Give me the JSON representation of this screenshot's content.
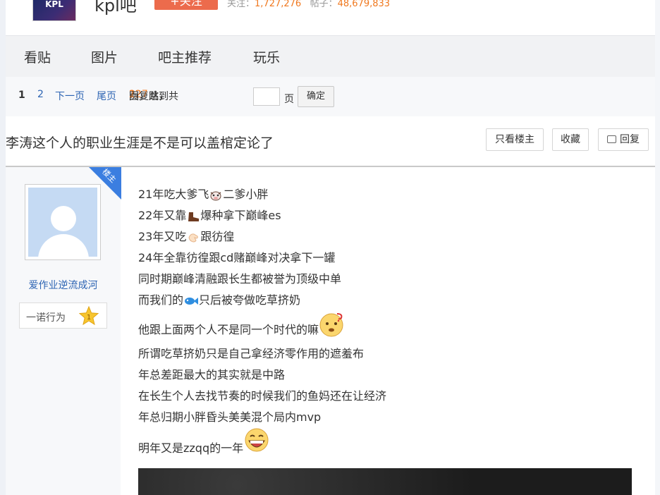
{
  "forum": {
    "logo_text": "KPL",
    "name": "kpl吧",
    "follow_label": "+关注",
    "followers_label": "关注：",
    "followers": "1,727,276",
    "posts_label": "帖子：",
    "posts": "48,679,833"
  },
  "nav": {
    "tabs": [
      "看贴",
      "图片",
      "吧主推荐",
      "玩乐"
    ]
  },
  "pager": {
    "current": "1",
    "page2": "2",
    "next": "下一页",
    "last": "尾页",
    "replies": "127",
    "replies_label": "回复贴，共",
    "pages": "2",
    "pages_label": "页，跳到",
    "page_unit": "页",
    "confirm": "确定"
  },
  "thread": {
    "title": "李涛这个人的职业生涯是不是可以盖棺定论了",
    "only_op": "只看楼主",
    "favorite": "收藏",
    "reply": "回复"
  },
  "post": {
    "op_badge": "楼主",
    "username": "爱作业逆流成河",
    "level_name": "一诺行为",
    "level_num": "1",
    "lines": [
      {
        "pre": "21年吃大爹飞",
        "icon": "cow-emoji",
        "post": "二爹小胖"
      },
      {
        "pre": "22年又靠",
        "icon": "boot-emoji",
        "post": "爆种拿下巅峰es"
      },
      {
        "pre": "23年又吃",
        "icon": "hand-emoji",
        "post": "跟彷徨"
      },
      {
        "pre": "24年全靠彷徨跟cd赌巅峰对决拿下一罐",
        "icon": "",
        "post": ""
      },
      {
        "pre": "同时期巅峰清融跟长生都被誉为顶级中单",
        "icon": "",
        "post": ""
      },
      {
        "pre": "而我们的",
        "icon": "fish-emoji",
        "post": "只后被夸做吃草挤奶"
      },
      {
        "pre": "他跟上面两个人不是同一个时代的嘛",
        "icon": "confused-face-emoji",
        "post": ""
      },
      {
        "pre": "所谓吃草挤奶只是自己拿经济零作用的遮羞布",
        "icon": "",
        "post": ""
      },
      {
        "pre": "年总差距最大的其实就是中路",
        "icon": "",
        "post": ""
      },
      {
        "pre": "在长生个人去找节奏的时候我们的鱼妈还在让经济",
        "icon": "",
        "post": ""
      },
      {
        "pre": "年总归期小胖昏头美美混个局内mvp",
        "icon": "",
        "post": ""
      },
      {
        "pre": "明年又是zzqq的一年",
        "icon": "laughing-face-emoji",
        "post": ""
      }
    ]
  }
}
